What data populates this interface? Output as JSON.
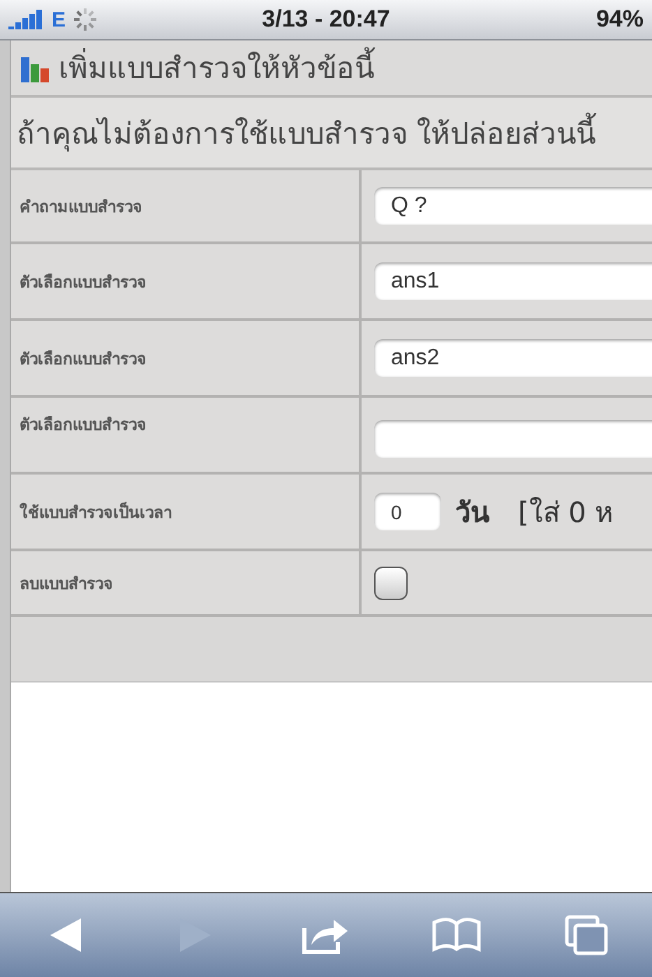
{
  "status_bar": {
    "carrier": "E",
    "time": "3/13 - 20:47",
    "battery": "94%"
  },
  "title": "เพิ่มแบบสำรวจให้หัวข้อนี้",
  "note": "ถ้าคุณไม่ต้องการใช้แบบสำรวจ ให้ปล่อยส่วนนี้",
  "rows": [
    {
      "kind": "text",
      "label": "คำถามแบบสำรวจ",
      "value": "Q ?"
    },
    {
      "kind": "text",
      "label": "ตัวเลือกแบบสำรวจ",
      "value": "ans1"
    },
    {
      "kind": "text",
      "label": "ตัวเลือกแบบสำรวจ",
      "value": "ans2"
    },
    {
      "kind": "text",
      "label": "ตัวเลือกแบบสำรวจ"
    },
    {
      "kind": "number",
      "label": "ใช้แบบสำรวจเป็นเวลา",
      "value": "0",
      "unit": "วัน",
      "hint": "[ใส่ 0 ห"
    },
    {
      "kind": "checkbox",
      "label": "ลบแบบสำรวจ",
      "checked": false
    }
  ],
  "toolbar": {
    "back_disabled": false,
    "forward_disabled": true
  }
}
